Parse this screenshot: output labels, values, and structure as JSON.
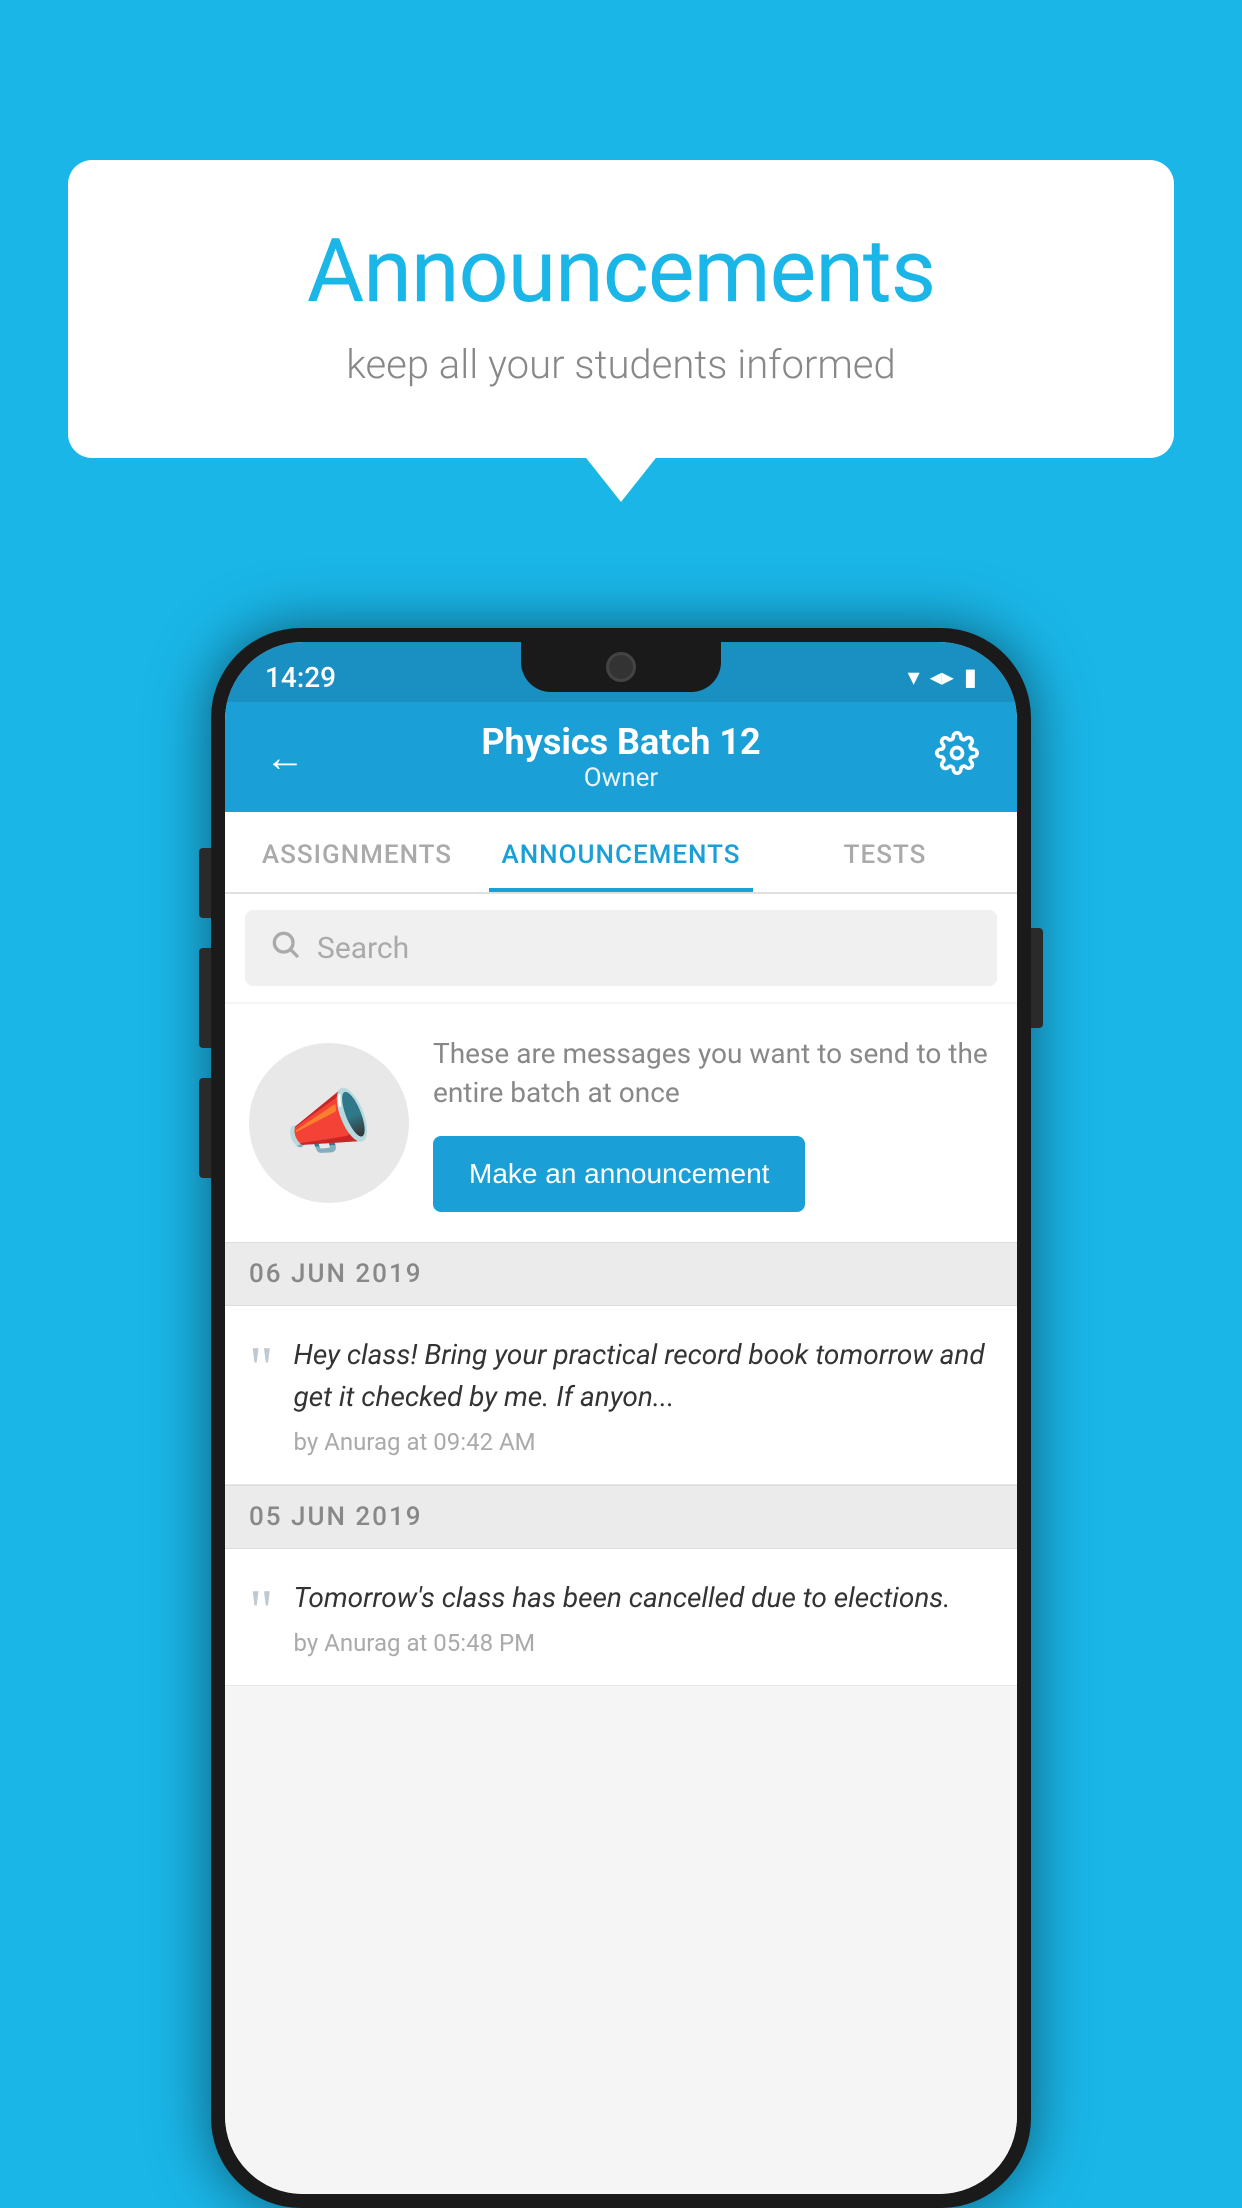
{
  "background_color": "#1ab6e8",
  "bubble": {
    "title": "Announcements",
    "subtitle": "keep all your students informed"
  },
  "phone": {
    "status_bar": {
      "time": "14:29"
    },
    "header": {
      "title": "Physics Batch 12",
      "subtitle": "Owner",
      "back_label": "←",
      "settings_label": "⚙"
    },
    "tabs": [
      {
        "label": "ASSIGNMENTS",
        "active": false
      },
      {
        "label": "ANNOUNCEMENTS",
        "active": true
      },
      {
        "label": "TESTS",
        "active": false
      },
      {
        "label": "...",
        "active": false
      }
    ],
    "search": {
      "placeholder": "Search"
    },
    "announcement_prompt": {
      "description": "These are messages you want to send to the entire batch at once",
      "button_label": "Make an announcement"
    },
    "dates": [
      {
        "label": "06  JUN  2019",
        "messages": [
          {
            "text": "Hey class! Bring your practical record book tomorrow and get it checked by me. If anyon...",
            "meta": "by Anurag at 09:42 AM"
          }
        ]
      },
      {
        "label": "05  JUN  2019",
        "messages": [
          {
            "text": "Tomorrow's class has been cancelled due to elections.",
            "meta": "by Anurag at 05:48 PM"
          }
        ]
      }
    ]
  }
}
